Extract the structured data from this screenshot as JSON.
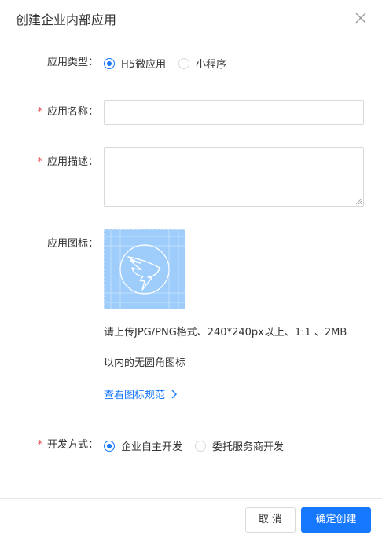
{
  "dialog": {
    "title": "创建企业内部应用",
    "close_icon": "close-icon"
  },
  "form": {
    "app_type": {
      "label": "应用类型：",
      "options": [
        "H5微应用",
        "小程序"
      ],
      "selected": "H5微应用"
    },
    "app_name": {
      "required_mark": "*",
      "label": "应用名称：",
      "value": "",
      "placeholder": ""
    },
    "app_desc": {
      "required_mark": "*",
      "label": "应用描述：",
      "value": "",
      "placeholder": ""
    },
    "app_icon": {
      "label": "应用图标：",
      "icon_name": "dingtalk-logo-icon",
      "hint_line1": "请上传JPG/PNG格式、240*240px以上、1:1 、2MB",
      "hint_line2": "以内的无圆角图标",
      "spec_link": "查看图标规范"
    },
    "dev_mode": {
      "required_mark": "*",
      "label": "开发方式：",
      "options": [
        "企业自主开发",
        "委托服务商开发"
      ],
      "selected": "企业自主开发"
    }
  },
  "footer": {
    "cancel_label": "取 消",
    "confirm_label": "确定创建"
  },
  "colors": {
    "primary": "#1677ff",
    "required": "#e5484d",
    "icon_bg": "#9fcdfb"
  }
}
